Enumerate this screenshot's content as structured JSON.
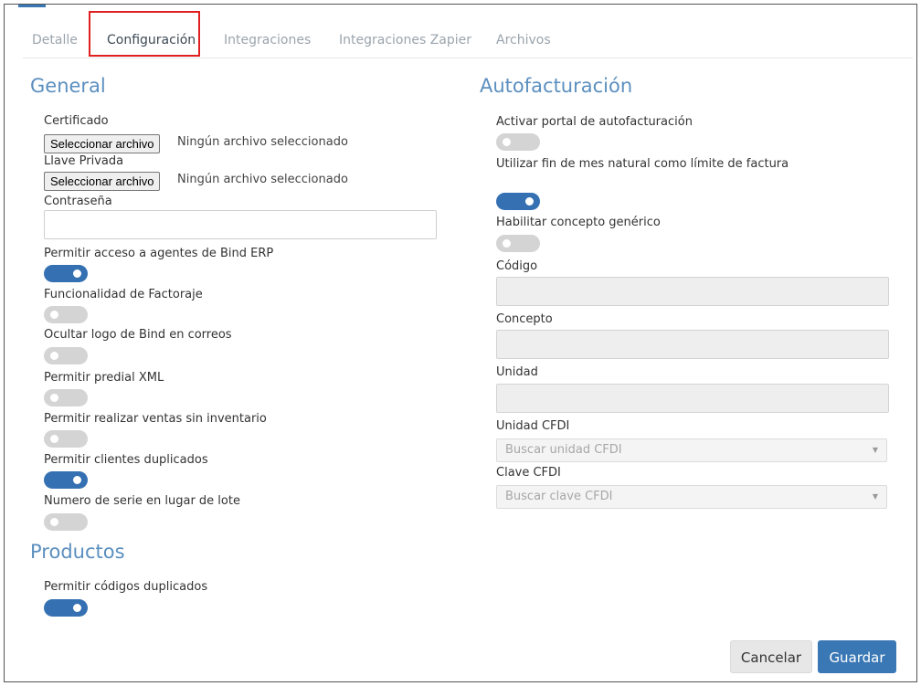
{
  "tabs": [
    "Detalle",
    "Configuración",
    "Integraciones",
    "Integraciones Zapier",
    "Archivos"
  ],
  "general": {
    "title": "General",
    "certificado_label": "Certificado",
    "llave_label": "Llave Privada",
    "file_button": "Seleccionar archivo",
    "no_file": "Ningún archivo seleccionado",
    "password_label": "Contraseña",
    "toggles": [
      {
        "label": "Permitir acceso a agentes de Bind ERP",
        "on": true
      },
      {
        "label": "Funcionalidad de Factoraje",
        "on": false
      },
      {
        "label": "Ocultar logo de Bind en correos",
        "on": false
      },
      {
        "label": "Permitir predial XML",
        "on": false
      },
      {
        "label": "Permitir realizar ventas sin inventario",
        "on": false
      },
      {
        "label": "Permitir clientes duplicados",
        "on": true
      },
      {
        "label": "Numero de serie en lugar de lote",
        "on": false
      }
    ]
  },
  "productos": {
    "title": "Productos",
    "toggles": [
      {
        "label": "Permitir códigos duplicados",
        "on": true
      }
    ]
  },
  "autofacturacion": {
    "title": "Autofacturación",
    "toggles": [
      {
        "label": "Activar portal de autofacturación",
        "on": false
      },
      {
        "label": "Utilizar fin de mes natural como límite de factura",
        "on": true
      },
      {
        "label": "Habilitar concepto genérico",
        "on": false
      }
    ],
    "codigo_label": "Código",
    "concepto_label": "Concepto",
    "unidad_label": "Unidad",
    "unidad_cfdi_label": "Unidad CFDI",
    "unidad_cfdi_placeholder": "Buscar unidad CFDI",
    "clave_cfdi_label": "Clave CFDI",
    "clave_cfdi_placeholder": "Buscar clave CFDI"
  },
  "actions": {
    "cancel": "Cancelar",
    "save": "Guardar"
  },
  "colors": {
    "accent": "#3a78b5",
    "highlight": "#e02020",
    "section_title": "#5b8fbf",
    "toggle_off": "#d4d4d4"
  }
}
